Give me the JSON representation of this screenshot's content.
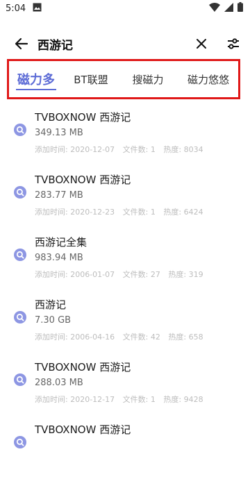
{
  "status_bar": {
    "time": "5:04"
  },
  "header": {
    "search_query": "西游记"
  },
  "tabs": [
    {
      "label": "磁力多",
      "active": true
    },
    {
      "label": "BT联盟",
      "active": false
    },
    {
      "label": "搜磁力",
      "active": false
    },
    {
      "label": "磁力悠悠",
      "active": false
    }
  ],
  "results": [
    {
      "title": "TVBOXNOW 西游记",
      "size": "349.13 MB",
      "added_label": "添加时间:",
      "added": "2020-12-07",
      "files_label": "文件数:",
      "files": "1",
      "heat_label": "热度:",
      "heat": "8034"
    },
    {
      "title": "TVBOXNOW 西游记",
      "size": "283.77 MB",
      "added_label": "添加时间:",
      "added": "2020-12-23",
      "files_label": "文件数:",
      "files": "1",
      "heat_label": "热度:",
      "heat": "6424"
    },
    {
      "title": "西游记全集",
      "size": "983.94 MB",
      "added_label": "添加时间:",
      "added": "2006-01-07",
      "files_label": "文件数:",
      "files": "27",
      "heat_label": "热度:",
      "heat": "319"
    },
    {
      "title": "西游记",
      "size": "7.30 GB",
      "added_label": "添加时间:",
      "added": "2006-04-16",
      "files_label": "文件数:",
      "files": "42",
      "heat_label": "热度:",
      "heat": "658"
    },
    {
      "title": "TVBOXNOW 西游记",
      "size": "288.03 MB",
      "added_label": "添加时间:",
      "added": "2020-12-17",
      "files_label": "文件数:",
      "files": "1",
      "heat_label": "热度:",
      "heat": "9428"
    },
    {
      "title": "TVBOXNOW 西游记",
      "size": "",
      "added_label": "",
      "added": "",
      "files_label": "",
      "files": "",
      "heat_label": "",
      "heat": ""
    }
  ],
  "colors": {
    "accent": "#5c6bd6",
    "highlight_box": "#e01818",
    "meta_text": "#bdbdbd"
  },
  "icons": {
    "result_icon": "magnet-search-icon",
    "back": "arrow-left-icon",
    "clear": "close-icon",
    "filter": "sliders-icon"
  }
}
